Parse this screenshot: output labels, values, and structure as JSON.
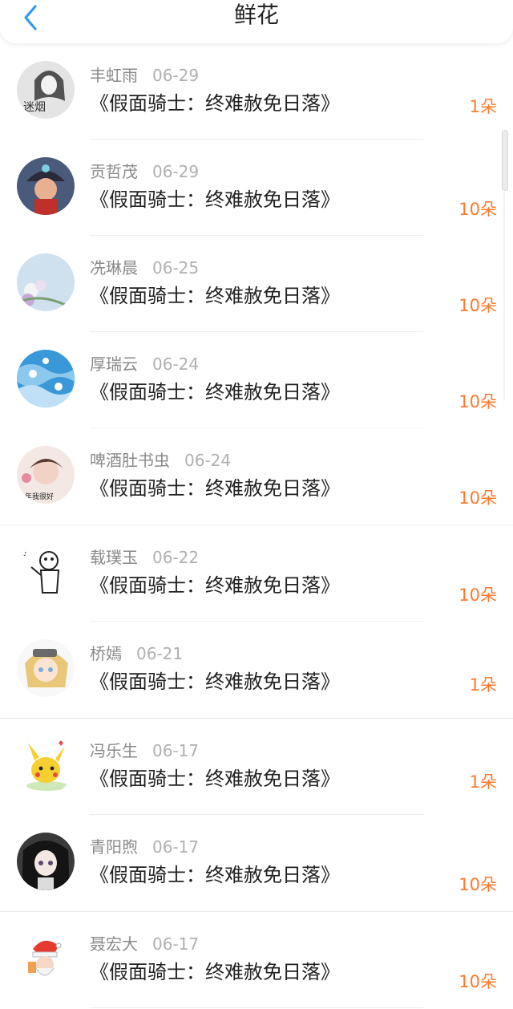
{
  "header": {
    "title": "鲜花",
    "back_icon": "chevron-left-icon",
    "accent": "#2f9bf6"
  },
  "colors": {
    "amount": "#ff7a2c"
  },
  "rows": [
    {
      "name": "丰虹雨",
      "date": "06-29",
      "book": "《假面骑士：终难赦免日落》",
      "amount": "1朵",
      "avatar_text": "迷烟"
    },
    {
      "name": "贡哲茂",
      "date": "06-29",
      "book": "《假面骑士：终难赦免日落》",
      "amount": "10朵"
    },
    {
      "name": "冼琳晨",
      "date": "06-25",
      "book": "《假面骑士：终难赦免日落》",
      "amount": "10朵"
    },
    {
      "name": "厚瑞云",
      "date": "06-24",
      "book": "《假面骑士：终难赦免日落》",
      "amount": "10朵"
    },
    {
      "name": "啤酒肚书虫",
      "date": "06-24",
      "book": "《假面骑士：终难赦免日落》",
      "amount": "10朵",
      "avatar_text": "年我很好"
    },
    {
      "name": "载璞玉",
      "date": "06-22",
      "book": "《假面骑士：终难赦免日落》",
      "amount": "10朵"
    },
    {
      "name": "桥嫣",
      "date": "06-21",
      "book": "《假面骑士：终难赦免日落》",
      "amount": "1朵"
    },
    {
      "name": "冯乐生",
      "date": "06-17",
      "book": "《假面骑士：终难赦免日落》",
      "amount": "1朵"
    },
    {
      "name": "青阳煦",
      "date": "06-17",
      "book": "《假面骑士：终难赦免日落》",
      "amount": "10朵"
    },
    {
      "name": "聂宏大",
      "date": "06-17",
      "book": "《假面骑士：终难赦免日落》",
      "amount": "10朵"
    }
  ]
}
